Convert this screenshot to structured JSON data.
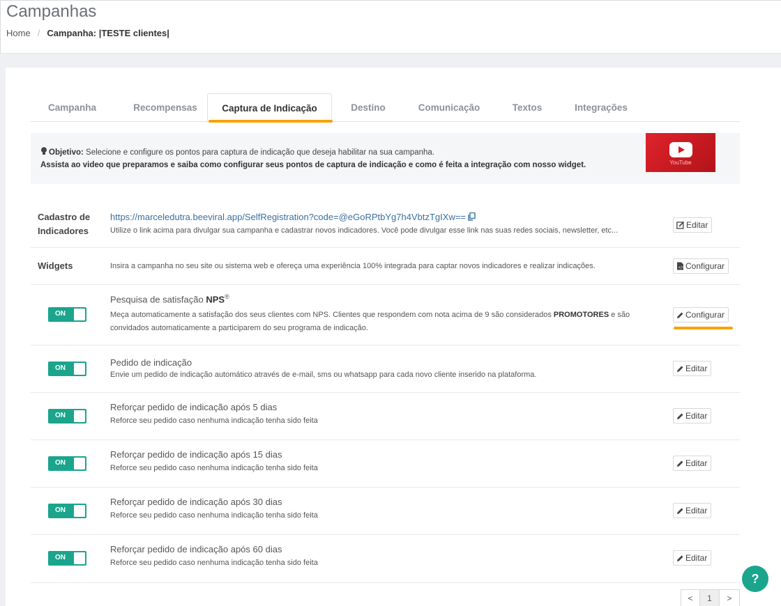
{
  "header": {
    "title": "Campanhas",
    "breadcrumb": {
      "home": "Home",
      "separator": "/",
      "current": "Campanha: |TESTE clientes|"
    }
  },
  "tabs": [
    {
      "label": "Campanha",
      "active": false
    },
    {
      "label": "Recompensas",
      "active": false
    },
    {
      "label": "Captura de Indicação",
      "active": true
    },
    {
      "label": "Destino",
      "active": false
    },
    {
      "label": "Comunicação",
      "active": false
    },
    {
      "label": "Textos",
      "active": false
    },
    {
      "label": "Integrações",
      "active": false
    }
  ],
  "info": {
    "objective_label": "Objetivo:",
    "objective_text": "Selecione e configure os pontos para captura de indicação que deseja habilitar na sua campanha.",
    "video_text": "Assista ao video que preparamos e saiba como configurar seus pontos de captura de indicação e como é feita a integração com nosso widget.",
    "video_label": "YouTube"
  },
  "cadastro": {
    "label": "Cadastro de Indicadores",
    "url": "https://marceledutra.beeviral.app/SelfRegistration?code=@eGoRPtbYg7h4VbtzTgIXw==",
    "description": "Utilize o link acima para divulgar sua campanha e cadastrar novos indicadores. Você pode divulgar esse link nas suas redes sociais, newsletter, etc...",
    "button": "Editar"
  },
  "widgets": {
    "label": "Widgets",
    "description": "Insira a campanha no seu site ou sistema web e ofereça uma experiência 100% integrada para captar novos indicadores e realizar indicações.",
    "button": "Configurar"
  },
  "nps": {
    "toggle": "ON",
    "title": "Pesquisa de satisfação",
    "title_bold": "NPS",
    "title_sup": "®",
    "description_1": "Meça automaticamente a satisfação dos seus clientes com NPS. Clientes que respondem com nota acima de 9 são considerados",
    "description_bold": "PROMOTORES",
    "description_2": "e são",
    "description_3": "convidados automaticamente a participarem do seu programa de indicação.",
    "button": "Configurar"
  },
  "items": [
    {
      "toggle": "ON",
      "title": "Pedido de indicação",
      "description": "Envie um pedido de indicação automático através de e-mail, sms ou whatsapp para cada novo cliente inserido na plataforma.",
      "button": "Editar"
    },
    {
      "toggle": "ON",
      "title": "Reforçar pedido de indicação após 5 dias",
      "description": "Reforce seu pedido caso nenhuma indicação tenha sido feita",
      "button": "Editar"
    },
    {
      "toggle": "ON",
      "title": "Reforçar pedido de indicação após 15 dias",
      "description": "Reforce seu pedido caso nenhuma indicação tenha sido feita",
      "button": "Editar"
    },
    {
      "toggle": "ON",
      "title": "Reforçar pedido de indicação após 30 dias",
      "description": "Reforce seu pedido caso nenhuma indicação tenha sido feita",
      "button": "Editar"
    },
    {
      "toggle": "ON",
      "title": "Reforçar pedido de indicação após 60 dias",
      "description": "Reforce seu pedido caso nenhuma indicação tenha sido feita",
      "button": "Editar"
    }
  ],
  "pagination": {
    "prev": "<",
    "page": "1",
    "next": ">"
  },
  "help_button": "?",
  "colors": {
    "accent_green": "#1aa58c",
    "highlight_orange": "#f5a300",
    "link_blue": "#3b6fa0"
  }
}
